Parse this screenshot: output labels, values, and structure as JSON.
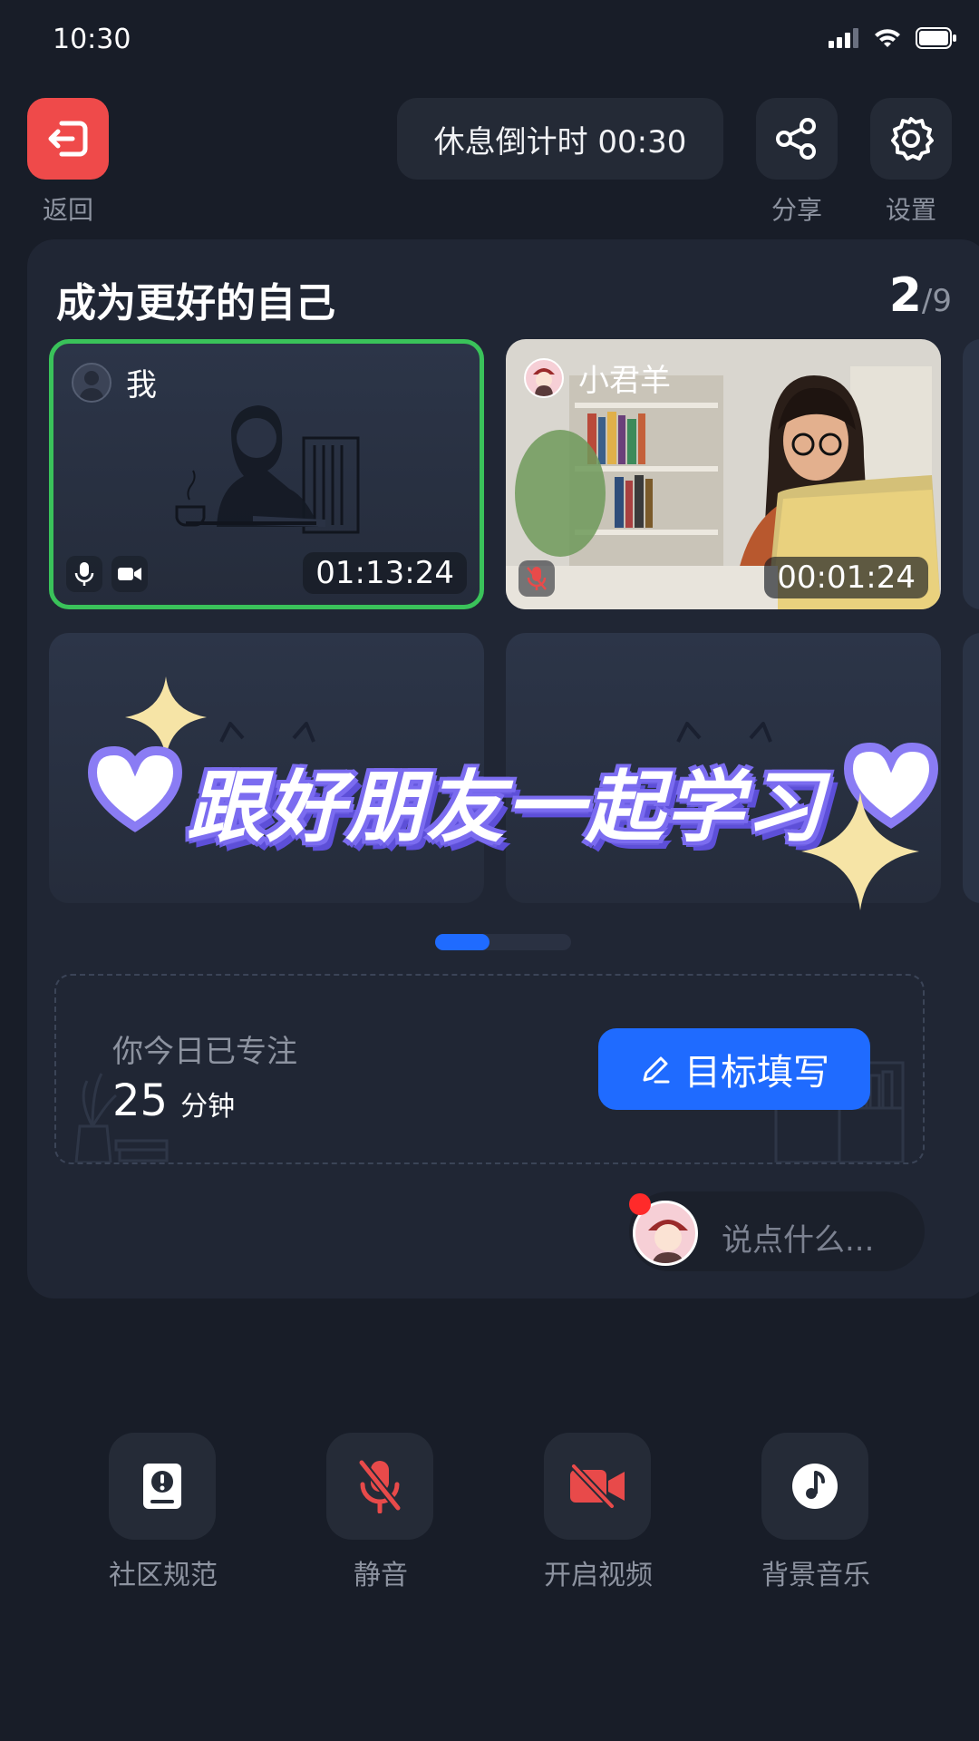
{
  "status_bar": {
    "time": "10:30"
  },
  "top_bar": {
    "back_label": "返回",
    "rest_countdown": "休息倒计时 00:30",
    "share_label": "分享",
    "settings_label": "设置"
  },
  "room": {
    "title": "成为更好的自己",
    "count_current": "2",
    "count_total": "/9",
    "tiles": [
      {
        "name": "我",
        "timer": "01:13:24"
      },
      {
        "name": "小君羊",
        "timer": "00:01:24"
      }
    ],
    "banner_text": "跟好朋友一起学习"
  },
  "focus": {
    "label": "你今日已专注",
    "value": "25",
    "unit": "分钟",
    "goal_button": "目标填写"
  },
  "chat": {
    "placeholder": "说点什么..."
  },
  "toolbar": [
    {
      "label": "社区规范",
      "icon": "community-rules-icon"
    },
    {
      "label": "静音",
      "icon": "mic-muted-icon"
    },
    {
      "label": "开启视频",
      "icon": "video-off-icon"
    },
    {
      "label": "背景音乐",
      "icon": "music-icon"
    }
  ],
  "colors": {
    "background": "#181d28",
    "panel": "#202634",
    "accent_blue": "#1f6bff",
    "back_red": "#ef4a4a",
    "active_green": "#3ac25a",
    "muted_red": "#e84a4a"
  }
}
